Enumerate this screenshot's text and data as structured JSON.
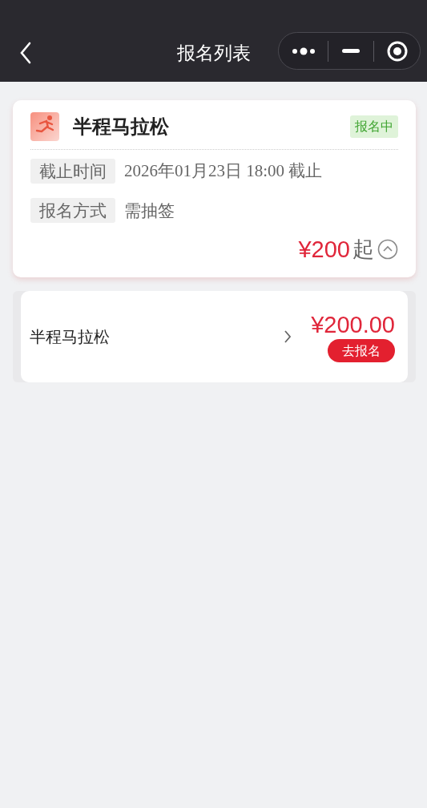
{
  "nav": {
    "title": "报名列表"
  },
  "event": {
    "name": "半程马拉松",
    "status": "报名中",
    "fields": [
      {
        "label": "截止时间",
        "value": "2026年01月23日 18:00 截止",
        "kind": "date"
      },
      {
        "label": "报名方式",
        "value": "需抽签",
        "kind": "text"
      }
    ],
    "price": "¥200",
    "price_suffix": "起",
    "expanded": true
  },
  "items": [
    {
      "name": "半程马拉松",
      "price": "¥200.00",
      "action": "去报名"
    }
  ]
}
